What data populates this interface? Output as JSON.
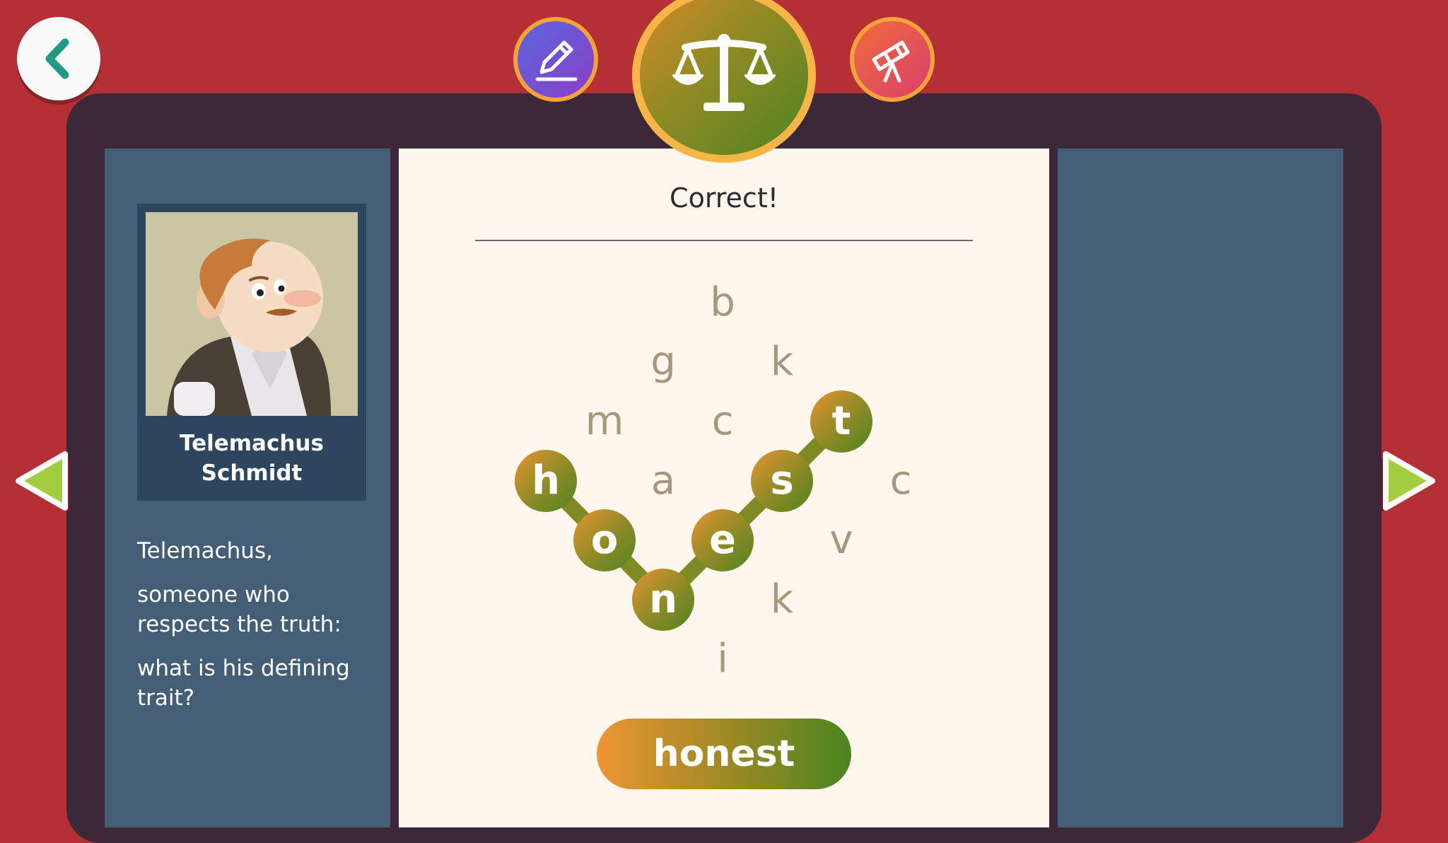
{
  "top_nav": {
    "back_icon": "chevron-left-icon",
    "modes": [
      {
        "icon": "pencil-icon",
        "active": false
      },
      {
        "icon": "scale-icon",
        "active": true
      },
      {
        "icon": "telescope-icon",
        "active": false
      }
    ]
  },
  "character": {
    "name_line1": "Telemachus",
    "name_line2": "Schmidt"
  },
  "prompt": {
    "line1": "Telemachus,",
    "line2": "someone who respects the truth:",
    "line3": "what is his defining trait?"
  },
  "status": "Correct!",
  "grid": {
    "letters": [
      "b",
      "g",
      "k",
      "m",
      "c",
      "h",
      "a",
      "s",
      "t",
      "c",
      "o",
      "e",
      "v",
      "n",
      "k",
      "i"
    ],
    "selected_word": [
      "h",
      "o",
      "n",
      "e",
      "s",
      "t"
    ]
  },
  "answer": {
    "label": "honest"
  },
  "colors": {
    "background": "#b53034",
    "frame": "#3c2839",
    "panel": "#445e76",
    "card": "#fff7ee",
    "accent_orange": "#ee9534",
    "accent_green": "#4a8520"
  }
}
